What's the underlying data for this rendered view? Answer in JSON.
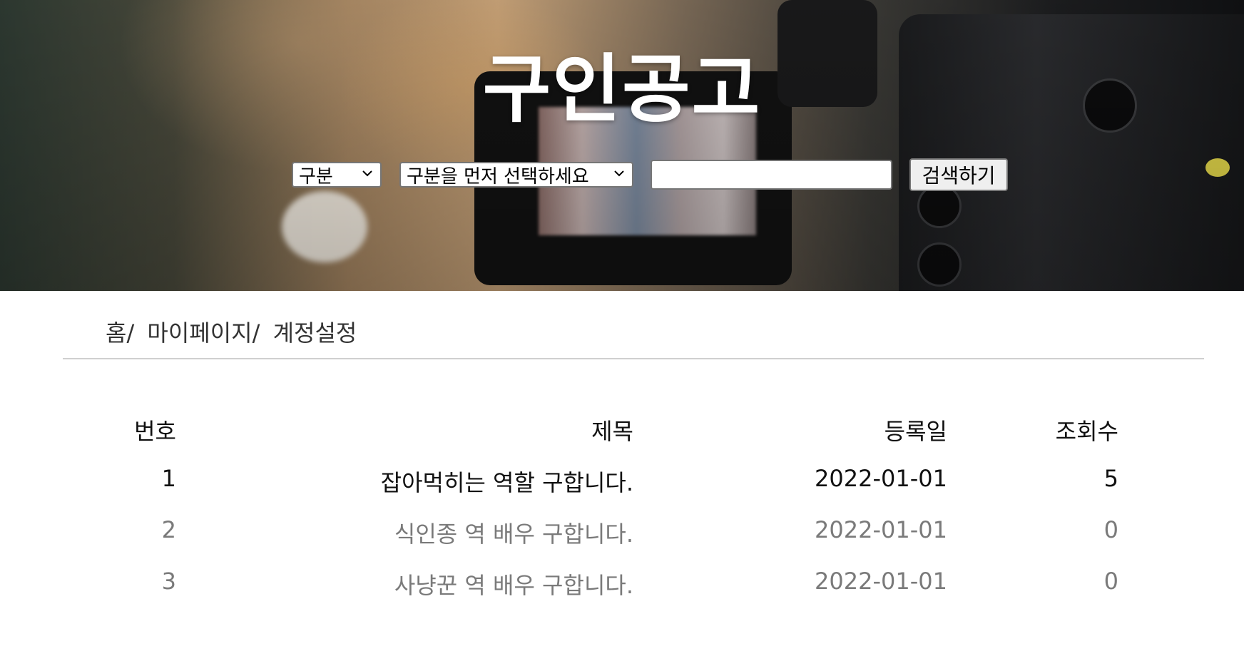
{
  "hero": {
    "title": "구인공고"
  },
  "search": {
    "category_selected": "구분",
    "subcategory_selected": "구분을 먼저 선택하세요",
    "query_value": "",
    "button_label": "검색하기"
  },
  "breadcrumb": {
    "items": [
      "홈/",
      "마이페이지/",
      "계정설정"
    ]
  },
  "table": {
    "headers": {
      "no": "번호",
      "title": "제목",
      "date": "등록일",
      "views": "조회수"
    },
    "rows": [
      {
        "no": "1",
        "title": "잡아먹히는 역할 구합니다.",
        "date": "2022-01-01",
        "views": "5"
      },
      {
        "no": "2",
        "title": "식인종 역 배우 구합니다.",
        "date": "2022-01-01",
        "views": "0"
      },
      {
        "no": "3",
        "title": "사냥꾼 역 배우 구합니다.",
        "date": "2022-01-01",
        "views": "0"
      }
    ]
  },
  "colors": {
    "active_row": "#111111",
    "inactive_row": "#7a7a7a",
    "divider": "#d0d0d0"
  }
}
